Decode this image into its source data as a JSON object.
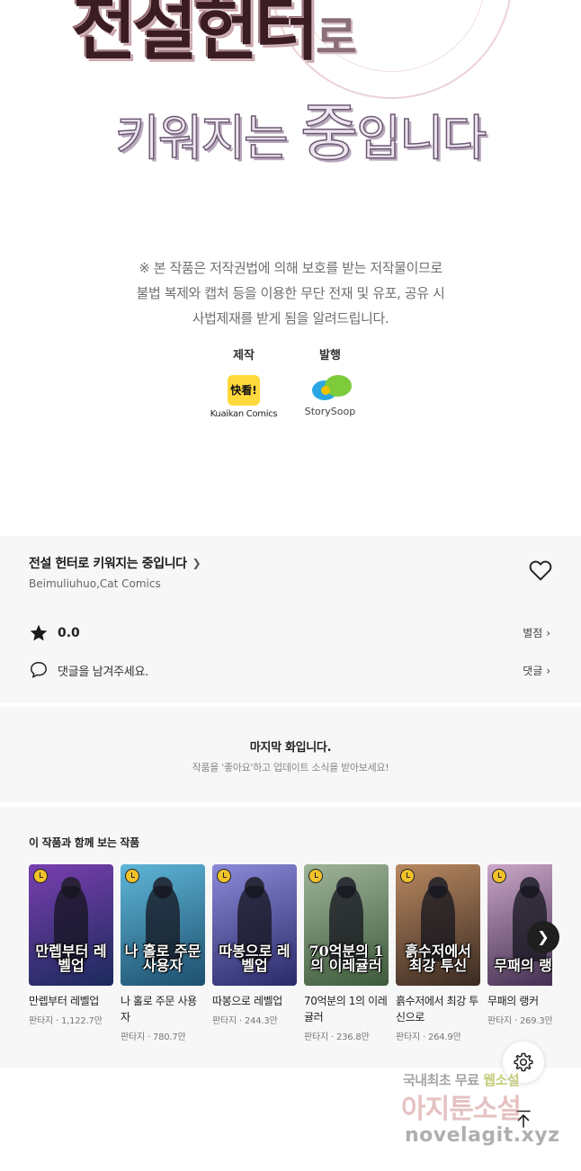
{
  "title_art": {
    "line1_main": "전설헌터",
    "line1_small": "로",
    "line2_a": "키워지는 ",
    "line2_big": "중",
    "line2_b": "입니다"
  },
  "notice": {
    "line1": "※ 본 작품은 저작권법에 의해 보호를 받는 저작물이므로",
    "line2": "불법 복제와 캡처 등을 이용한 무단 전재 및 유포, 공유 시",
    "line3": "사법제재를 받게 됨을 알려드립니다."
  },
  "credits": {
    "production_label": "제작",
    "production_logo": "快看!",
    "production_name": "Kuaikan Comics",
    "publisher_label": "발행",
    "publisher_name": "StorySoop"
  },
  "work": {
    "title": "전설 헌터로 키워지는 중입니다",
    "author": "Beimuliuhuo,Cat Comics",
    "rating": "0.0",
    "rate_link": "별점",
    "comment_prompt": "댓글을 남겨주세요.",
    "comment_link": "댓글"
  },
  "last_episode": {
    "title": "마지막 화입니다.",
    "subtitle": "작품을 '좋아요'하고 업데이트 소식을 받아보세요!"
  },
  "recommendations": {
    "heading": "이 작품과 함께 보는 작품",
    "items": [
      {
        "title": "만렙부터 레벨업",
        "genre": "판타지",
        "views": "1,122.7만",
        "logo": "만렙부터 레벨업",
        "bg1": "#1b2a5c",
        "bg2": "#7a3fb0"
      },
      {
        "title": "나 홀로 주문 사용자",
        "genre": "판타지",
        "views": "780.7만",
        "logo": "나 홀로 주문 사용자",
        "bg1": "#1d4f6e",
        "bg2": "#5fb6d8"
      },
      {
        "title": "따봉으로 레벨업",
        "genre": "판타지",
        "views": "244.3만",
        "logo": "따봉으로 레벨업",
        "bg1": "#2a2a6a",
        "bg2": "#8a8ad8"
      },
      {
        "title": "70억분의 1의 이레귤러",
        "genre": "판타지",
        "views": "236.8만",
        "logo": "70억분의 1의 이레귤러",
        "bg1": "#3d5a3a",
        "bg2": "#9fb49a"
      },
      {
        "title": "흙수저에서 최강 투신으로",
        "genre": "판타지",
        "views": "264.9만",
        "logo": "흙수저에서 최강 투신",
        "bg1": "#3a2a22",
        "bg2": "#b88860"
      },
      {
        "title": "무패의 랭커",
        "genre": "판타지",
        "views": "269.3만",
        "logo": "무패의 랭커",
        "bg1": "#3e2a4c",
        "bg2": "#c9a6c7"
      }
    ]
  },
  "watermark": {
    "line1a": "국내최초 무료 ",
    "line1b": "웹소설",
    "line2": "아지툰소설",
    "line3": "novelagit.xyz"
  },
  "icons": {
    "heart": "heart-icon",
    "star": "star-icon",
    "comment": "comment-icon",
    "settings": "gear-icon",
    "top": "arrow-up-icon",
    "next": "chevron-right-icon"
  }
}
